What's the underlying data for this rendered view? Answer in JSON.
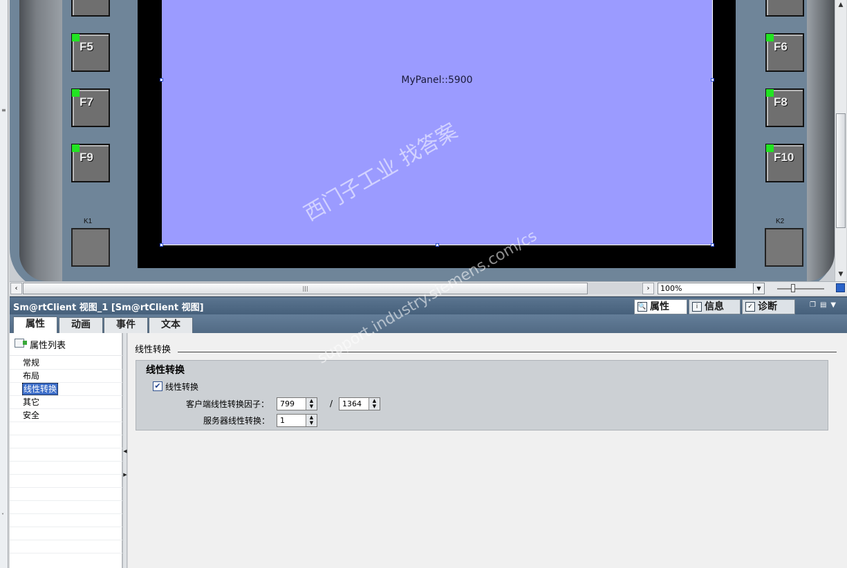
{
  "canvas": {
    "screen_label": "MyPanel::5900",
    "keys_left": [
      "F5",
      "F7",
      "F9"
    ],
    "keys_right": [
      "F6",
      "F8",
      "F10"
    ],
    "k_left": "K1",
    "k_right": "K2"
  },
  "zoom": {
    "value": "100%"
  },
  "inspector": {
    "title": "Sm@rtClient 视图_1 [Sm@rtClient 视图]",
    "right_tabs": [
      "属性",
      "信息",
      "诊断"
    ],
    "tabs": [
      "属性",
      "动画",
      "事件",
      "文本"
    ]
  },
  "nav": {
    "header": "属性列表",
    "items": [
      "常规",
      "布局",
      "线性转换",
      "其它",
      "安全"
    ]
  },
  "content": {
    "section_title": "线性转换",
    "group_title": "线性转换",
    "checkbox_label": "线性转换",
    "checkbox_checked": true,
    "client_label": "客户端线性转换因子：",
    "client_value_1": "799",
    "separator": "/",
    "client_value_2": "1364",
    "server_label": "服务器线性转换：",
    "server_value": "1"
  },
  "watermark": {
    "line1": "西门子工业  找答案",
    "line2": "support.industry.siemens.com/cs"
  }
}
